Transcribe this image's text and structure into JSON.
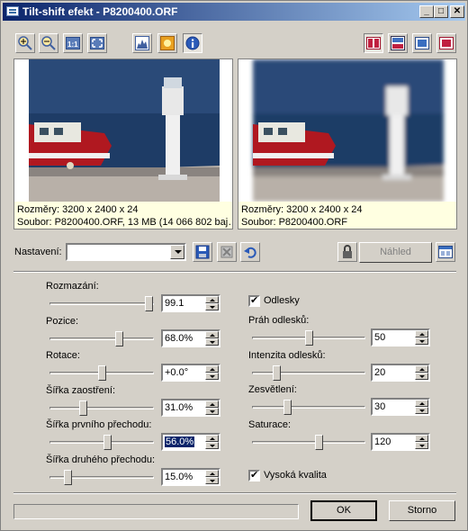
{
  "window": {
    "title": "Tilt-shift efekt - P8200400.ORF"
  },
  "title_buttons": {
    "minimize": "_",
    "maximize": "□",
    "close": "✕"
  },
  "toolbar": {
    "left_tools": [
      "zoom-in-icon",
      "zoom-out-icon",
      "actual-size-icon",
      "fit-icon",
      "histogram-icon",
      "highlight-icon",
      "info-icon"
    ],
    "right_tools": [
      "split-vertical-icon",
      "split-horizontal-icon",
      "single-before-icon",
      "single-after-icon"
    ]
  },
  "preview_before": {
    "line1": "Rozměry: 3200 x 2400 x 24",
    "line2": "Soubor: P8200400.ORF, 13 MB (14 066 802 baj…"
  },
  "preview_after": {
    "line1": "Rozměry: 3200 x 2400 x 24",
    "line2": "Soubor: P8200400.ORF"
  },
  "settings": {
    "label": "Nastavení:",
    "value": "",
    "preview_button": "Náhled"
  },
  "left_params": [
    {
      "label": "Rozmazání:",
      "value": "99.1",
      "level": 0.991,
      "selected": false
    },
    {
      "label": "Pozice:",
      "value": "68.0%",
      "level": 0.68,
      "selected": false
    },
    {
      "label": "Rotace:",
      "value": "+0.0°",
      "level": 0.5,
      "selected": false
    },
    {
      "label": "Šířka zaostření:",
      "value": "31.0%",
      "level": 0.31,
      "selected": false
    },
    {
      "label": "Šířka prvního přechodu:",
      "value": "56.0%",
      "level": 0.56,
      "selected": true
    },
    {
      "label": "Šířka druhého přechodu:",
      "value": "15.0%",
      "level": 0.15,
      "selected": false
    }
  ],
  "reflections": {
    "label": "Odlesky",
    "checked": true
  },
  "right_params": [
    {
      "label": "Práh odlesků:",
      "value": "50",
      "level": 0.5
    },
    {
      "label": "Intenzita odlesků:",
      "value": "20",
      "level": 0.2
    },
    {
      "label": "Zesvětlení:",
      "value": "30",
      "level": 0.3
    },
    {
      "label": "Saturace:",
      "value": "120",
      "level": 0.6
    }
  ],
  "high_quality": {
    "label": "Vysoká kvalita",
    "checked": true
  },
  "buttons": {
    "ok": "OK",
    "cancel": "Storno"
  },
  "progress": 0
}
